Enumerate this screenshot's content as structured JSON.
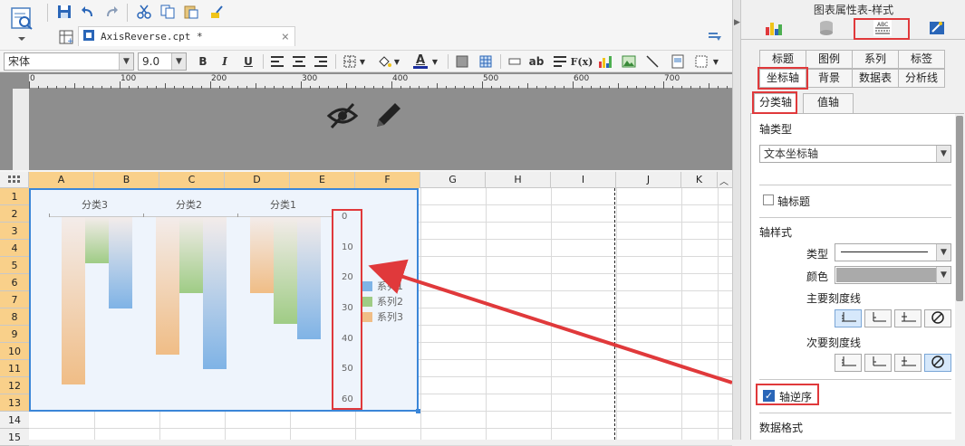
{
  "file_tab": {
    "name": "AxisReverse.cpt *",
    "close": "×"
  },
  "format": {
    "font_name": "宋体",
    "font_size": "9.0",
    "bold": "B",
    "italic": "I",
    "underline": "U",
    "text_a": "A",
    "text_ab": "ab",
    "fx": "F(x)"
  },
  "ruler": {
    "labels": [
      "0",
      "100",
      "200",
      "300",
      "400",
      "500",
      "600",
      "700"
    ]
  },
  "columns": [
    "A",
    "B",
    "C",
    "D",
    "E",
    "F",
    "G",
    "H",
    "I",
    "J",
    "K"
  ],
  "rows": [
    "1",
    "2",
    "3",
    "4",
    "5",
    "6",
    "7",
    "8",
    "9",
    "10",
    "11",
    "12",
    "13",
    "14",
    "15"
  ],
  "chart_data": {
    "type": "bar",
    "orientation": "vertical",
    "y_axis_reversed": true,
    "categories": [
      "分类3",
      "分类2",
      "分类1"
    ],
    "series": [
      {
        "name": "系列3",
        "color": "#f0bd86",
        "values": [
          55,
          45,
          25
        ]
      },
      {
        "name": "系列2",
        "color": "#9fcc85",
        "values": [
          15,
          25,
          35
        ]
      },
      {
        "name": "系列1",
        "color": "#7fb3e6",
        "values": [
          30,
          50,
          40
        ]
      }
    ],
    "yticks": [
      "0",
      "10",
      "20",
      "30",
      "40",
      "50",
      "60"
    ],
    "ylim": [
      0,
      60
    ],
    "legend": [
      "系列1",
      "系列2",
      "系列3"
    ],
    "legend_position": "right"
  },
  "panel": {
    "title": "图表属性表-样式",
    "row1_tabs": [
      "标题",
      "图例",
      "系列",
      "标签"
    ],
    "row2_tabs": [
      "坐标轴",
      "背景",
      "数据表",
      "分析线"
    ],
    "sub_tabs": [
      "分类轴",
      "值轴"
    ],
    "axis_type_label": "轴类型",
    "axis_type_value": "文本坐标轴",
    "axis_title_label": "轴标题",
    "axis_style_label": "轴样式",
    "type_label": "类型",
    "color_label": "颜色",
    "major_tick_label": "主要刻度线",
    "minor_tick_label": "次要刻度线",
    "reverse_label": "轴逆序",
    "reverse_checked": true,
    "data_format_label": "数据格式",
    "accent_color": "#e0393b"
  }
}
